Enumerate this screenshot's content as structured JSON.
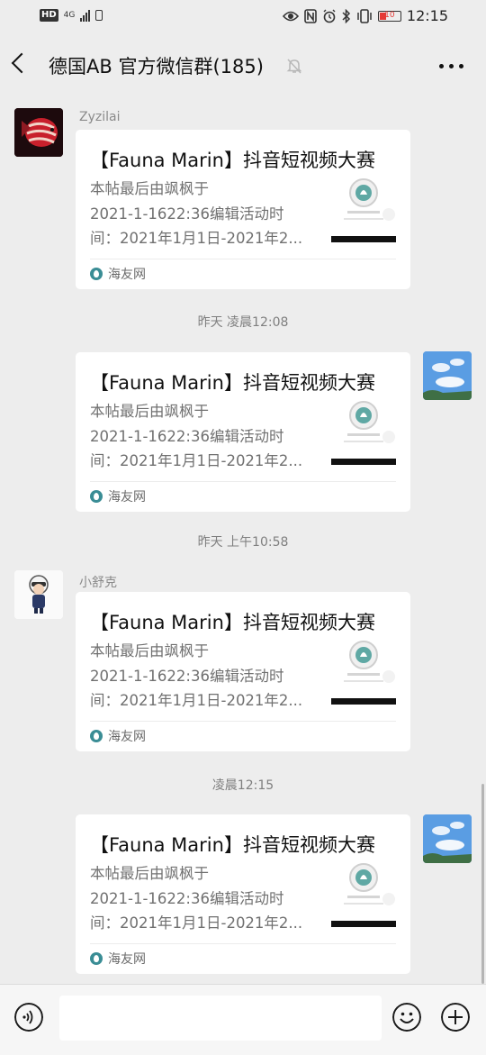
{
  "status_bar": {
    "hd": "HD",
    "network": "4G",
    "battery": "10",
    "time": "12:15"
  },
  "header": {
    "title": "德国AB  官方微信群(185)"
  },
  "messages": [
    {
      "type": "card",
      "side": "left",
      "sender": "Zyzilai",
      "avatar": "fish-avatar",
      "title": "【Fauna Marin】抖音短视频大赛",
      "lines": [
        "本帖最后由飒枫于",
        "2021-1-1622:36编辑活动时",
        "间：2021年1月1日-2021年2..."
      ],
      "source": "海友网"
    },
    {
      "type": "time",
      "text": "昨天 凌晨12:08"
    },
    {
      "type": "card",
      "side": "right",
      "avatar": "sky-avatar",
      "title": "【Fauna Marin】抖音短视频大赛",
      "lines": [
        "本帖最后由飒枫于",
        "2021-1-1622:36编辑活动时",
        "间：2021年1月1日-2021年2..."
      ],
      "source": "海友网"
    },
    {
      "type": "time",
      "text": "昨天 上午10:58"
    },
    {
      "type": "card",
      "side": "left",
      "sender": "小舒克",
      "avatar": "pilot-avatar",
      "title": "【Fauna Marin】抖音短视频大赛",
      "lines": [
        "本帖最后由飒枫于",
        "2021-1-1622:36编辑活动时",
        "间：2021年1月1日-2021年2..."
      ],
      "source": "海友网"
    },
    {
      "type": "time",
      "text": "凌晨12:15"
    },
    {
      "type": "card",
      "side": "right",
      "avatar": "sky-avatar",
      "title": "【Fauna Marin】抖音短视频大赛",
      "lines": [
        "本帖最后由飒枫于",
        "2021-1-1622:36编辑活动时",
        "间：2021年1月1日-2021年2..."
      ],
      "source": "海友网"
    }
  ],
  "input": {
    "placeholder": ""
  }
}
